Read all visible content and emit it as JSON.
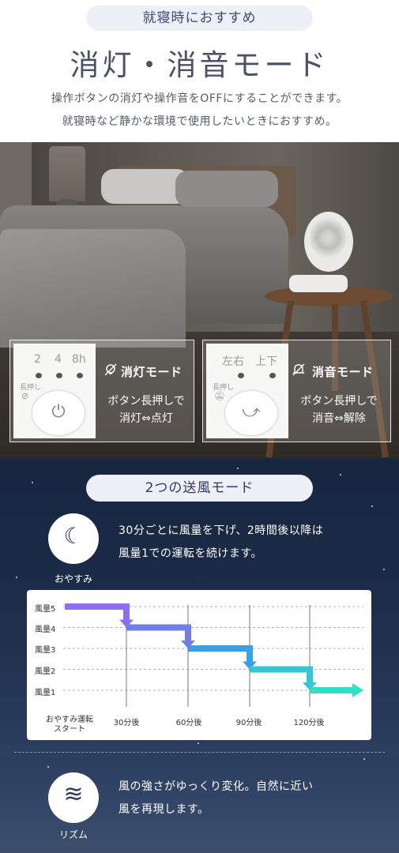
{
  "header": {
    "pill": "就寝時におすすめ",
    "title": "消灯・消音モード",
    "lead1": "操作ボタンの消灯や操作音をOFFにすることができます。",
    "lead2": "就寝時など静かな環境で使用したいときにおすすめ。"
  },
  "card_light": {
    "labels": [
      "2",
      "4",
      "8h"
    ],
    "press": "長押し",
    "title": "消灯モード",
    "desc1": "ボタン長押しで",
    "desc2": "消灯⇔点灯"
  },
  "card_sound": {
    "labels": [
      "左右",
      "上下"
    ],
    "press": "長押し",
    "title": "消音モード",
    "desc1": "ボタン長押しで",
    "desc2": "消音⇔解除"
  },
  "wind": {
    "pill": "2つの送風モード",
    "oyasumi": {
      "label": "おやすみ",
      "icon": "moon-icon",
      "text1": "30分ごとに風量を下げ、2時間後以降は",
      "text2": "風量1での運転を続けます。"
    },
    "rhythm": {
      "label": "リズム",
      "icon": "wind-icon",
      "text1": "風の強さがゆっくり変化。自然に近い",
      "text2": "風を再現します。"
    }
  },
  "chart_data": {
    "type": "line",
    "categories": [
      "おやすみ運転\nスタート",
      "30分後",
      "60分後",
      "90分後",
      "120分後"
    ],
    "y_categories": [
      "風量1",
      "風量2",
      "風量3",
      "風量4",
      "風量5"
    ],
    "values": [
      5,
      4,
      3,
      2,
      1
    ],
    "colors": [
      "#8e6ff0",
      "#6f7fe6",
      "#3aa0e0",
      "#35c6d4",
      "#2fe0c8"
    ]
  }
}
